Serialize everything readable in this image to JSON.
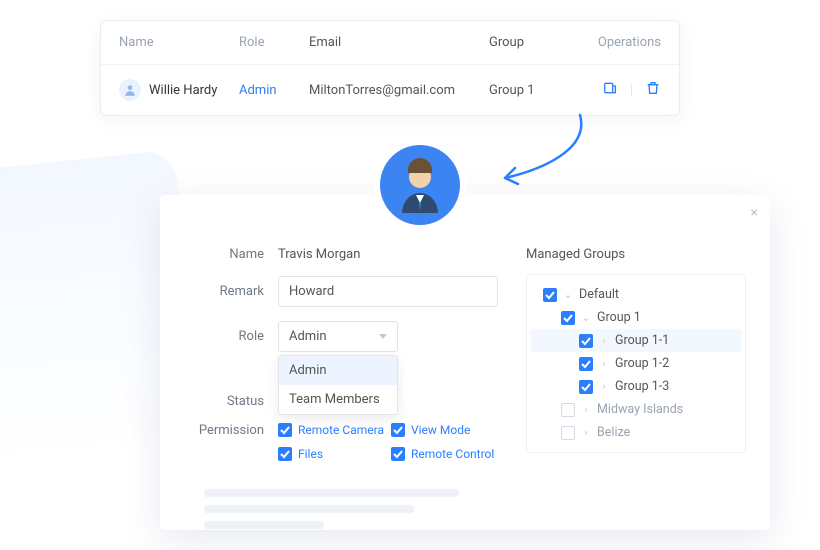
{
  "table": {
    "headers": {
      "name": "Name",
      "role": "Role",
      "email": "Email",
      "group": "Group",
      "ops": "Operations"
    },
    "row": {
      "name": "Willie Hardy",
      "role": "Admin",
      "email": "MiltonTorres@gmail.com",
      "group": "Group 1"
    }
  },
  "form": {
    "labels": {
      "name": "Name",
      "remark": "Remark",
      "role": "Role",
      "status": "Status",
      "permission": "Permission",
      "managed_groups": "Managed Groups"
    },
    "name_value": "Travis Morgan",
    "remark_value": "Howard",
    "role_value": "Admin",
    "role_options": [
      "Admin",
      "Team Members"
    ],
    "permissions": [
      {
        "label": "Remote Camera",
        "checked": true
      },
      {
        "label": "View Mode",
        "checked": true
      },
      {
        "label": "Files",
        "checked": true
      },
      {
        "label": "Remote Control",
        "checked": true
      }
    ],
    "groups": [
      {
        "label": "Default",
        "depth": 0,
        "checked": true,
        "expanded": true,
        "highlight": false
      },
      {
        "label": "Group 1",
        "depth": 1,
        "checked": true,
        "expanded": true,
        "highlight": false
      },
      {
        "label": "Group 1-1",
        "depth": 2,
        "checked": true,
        "expanded": false,
        "highlight": true
      },
      {
        "label": "Group 1-2",
        "depth": 2,
        "checked": true,
        "expanded": false,
        "highlight": false
      },
      {
        "label": "Group 1-3",
        "depth": 2,
        "checked": true,
        "expanded": false,
        "highlight": false
      },
      {
        "label": "Midway Islands",
        "depth": 1,
        "checked": false,
        "expanded": false,
        "highlight": false
      },
      {
        "label": "Belize",
        "depth": 1,
        "checked": false,
        "expanded": false,
        "highlight": false
      }
    ]
  },
  "icons": {
    "edit": "edit-icon",
    "delete": "trash-icon"
  }
}
